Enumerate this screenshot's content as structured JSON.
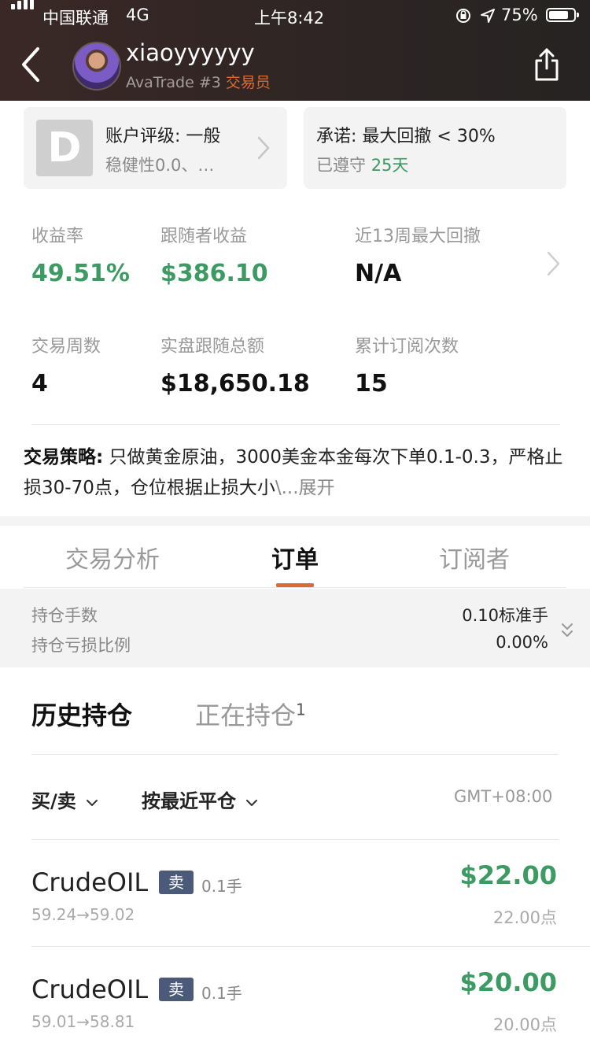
{
  "status_bar": {
    "carrier": "中国联通",
    "network": "4G",
    "time": "上午8:42",
    "battery": "75%"
  },
  "header": {
    "username": "xiaoyyyyyy",
    "subtitle_rank": "AvaTrade #3",
    "subtitle_role": "交易员"
  },
  "rating_card": {
    "grade": "D",
    "title": "账户评级: 一般",
    "subtitle": "稳健性0.0、…"
  },
  "commitment_card": {
    "title": "承诺: 最大回撤 < 30%",
    "kept_label": "已遵守",
    "kept_days": "25天"
  },
  "stats": [
    {
      "label": "收益率",
      "value": "49.51%"
    },
    {
      "label": "跟随者收益",
      "value": "$386.10"
    },
    {
      "label": "近13周最大回撤",
      "value": "N/A"
    },
    {
      "label": "交易周数",
      "value": "4"
    },
    {
      "label": "实盘跟随总额",
      "value": "$18,650.18"
    },
    {
      "label": "累计订阅次数",
      "value": "15"
    }
  ],
  "strategy": {
    "label": "交易策略:",
    "text": " 只做黄金原油，3000美金本金每次下单0.1-0.3，严格止损30-70点，仓位根据止损大小",
    "ellipsis": "\\...",
    "more": "展开"
  },
  "tabs": [
    "交易分析",
    "订单",
    "订阅者"
  ],
  "active_tab": "订单",
  "summary": {
    "lots_label": "持仓手数",
    "lots_value": "0.10标准手",
    "loss_label": "持仓亏损比例",
    "loss_value": "0.00%"
  },
  "position_tabs": {
    "history": "历史持仓",
    "open": "正在持仓",
    "open_count": "1"
  },
  "filters": {
    "side": "买/卖",
    "sort": "按最近平仓",
    "timezone": "GMT+08:00"
  },
  "orders": [
    {
      "symbol": "CrudeOIL",
      "side": "卖",
      "lots": "0.1手",
      "prices": "59.24→59.02",
      "profit": "$22.00",
      "points": "22.00点"
    },
    {
      "symbol": "CrudeOIL",
      "side": "卖",
      "lots": "0.1手",
      "prices": "59.01→58.81",
      "profit": "$20.00",
      "points": "20.00点"
    }
  ],
  "colors": {
    "profit_green": "#3c9a63",
    "accent_orange": "#e06a2a",
    "sell_badge": "#4a5a78"
  }
}
